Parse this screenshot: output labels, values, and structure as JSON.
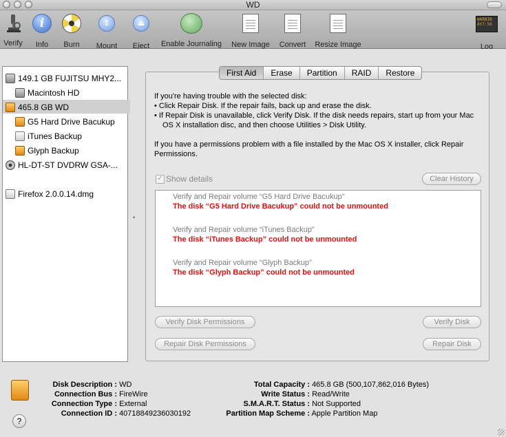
{
  "window": {
    "title": "WD"
  },
  "toolbar": {
    "items": [
      {
        "label": "Verify",
        "icon": "microscope-icon"
      },
      {
        "label": "Info",
        "icon": "info-icon"
      },
      {
        "label": "Burn",
        "icon": "burn-icon"
      },
      {
        "label": "Mount",
        "icon": "mount-icon"
      },
      {
        "label": "Eject",
        "icon": "eject-icon"
      },
      {
        "label": "Enable Journaling",
        "icon": "journaling-icon"
      },
      {
        "label": "New Image",
        "icon": "new-image-icon"
      },
      {
        "label": "Convert",
        "icon": "convert-icon"
      },
      {
        "label": "Resize Image",
        "icon": "resize-image-icon"
      },
      {
        "label": "Log",
        "icon": "log-icon",
        "icon_text": "WARNIN\nAY7:56"
      }
    ]
  },
  "sidebar": {
    "items": [
      {
        "label": "149.1 GB FUJITSU MHY2...",
        "icon": "hard-disk-icon"
      },
      {
        "label": "Macintosh HD",
        "icon": "volume-icon"
      },
      {
        "label": "465.8 GB WD",
        "icon": "external-disk-icon"
      },
      {
        "label": "G5 Hard Drive Bacukup",
        "icon": "external-volume-icon"
      },
      {
        "label": "iTunes Backup",
        "icon": "volume-icon"
      },
      {
        "label": "Glyph Backup",
        "icon": "external-volume-icon"
      },
      {
        "label": "HL-DT-ST DVDRW GSA-...",
        "icon": "optical-drive-icon"
      },
      {
        "label": "Firefox 2.0.0.14.dmg",
        "icon": "disk-image-icon"
      }
    ]
  },
  "tabs": [
    "First Aid",
    "Erase",
    "Partition",
    "RAID",
    "Restore"
  ],
  "first_aid": {
    "intro": "If you're having trouble with the selected disk:",
    "bullet1": "• Click Repair Disk. If the repair fails, back up and erase the disk.",
    "bullet2": "• If Repair Disk is unavailable, click Verify Disk. If the disk needs repairs, start up from your Mac OS X installation disc, and then choose Utilities > Disk Utility.",
    "permissions_text": "If you have a permissions problem with a file installed by the Mac OS X installer, click Repair Permissions.",
    "show_details": "Show details",
    "clear_history": "Clear History",
    "log": [
      {
        "action": "Verify and Repair volume “G5 Hard Drive Bacukup”",
        "error": "The disk “G5 Hard Drive Bacukup” could not be unmounted"
      },
      {
        "action": "Verify and Repair volume “iTunes Backup”",
        "error": "The disk “iTunes Backup” could not be unmounted"
      },
      {
        "action": "Verify and Repair volume “Glyph Backup”",
        "error": "The disk “Glyph Backup” could not be unmounted"
      }
    ],
    "buttons": {
      "verify_permissions": "Verify Disk Permissions",
      "repair_permissions": "Repair Disk Permissions",
      "verify_disk": "Verify Disk",
      "repair_disk": "Repair Disk"
    }
  },
  "info": {
    "left": [
      {
        "key": "Disk Description :",
        "value": "WD"
      },
      {
        "key": "Connection Bus :",
        "value": "FireWire"
      },
      {
        "key": "Connection Type :",
        "value": "External"
      },
      {
        "key": "Connection ID :",
        "value": "4071884923603019​2"
      }
    ],
    "right": [
      {
        "key": "Total Capacity :",
        "value": "465.8 GB (500,107,862,016 Bytes)"
      },
      {
        "key": "Write Status :",
        "value": "Read/Write"
      },
      {
        "key": "S.M.A.R.T. Status :",
        "value": "Not Supported"
      },
      {
        "key": "Partition Map Scheme :",
        "value": "Apple Partition Map"
      }
    ],
    "help": "?"
  },
  "colors": {
    "error": "#e01010",
    "selection": "#d0d0d0",
    "disabled_text": "#8a8a8a"
  }
}
